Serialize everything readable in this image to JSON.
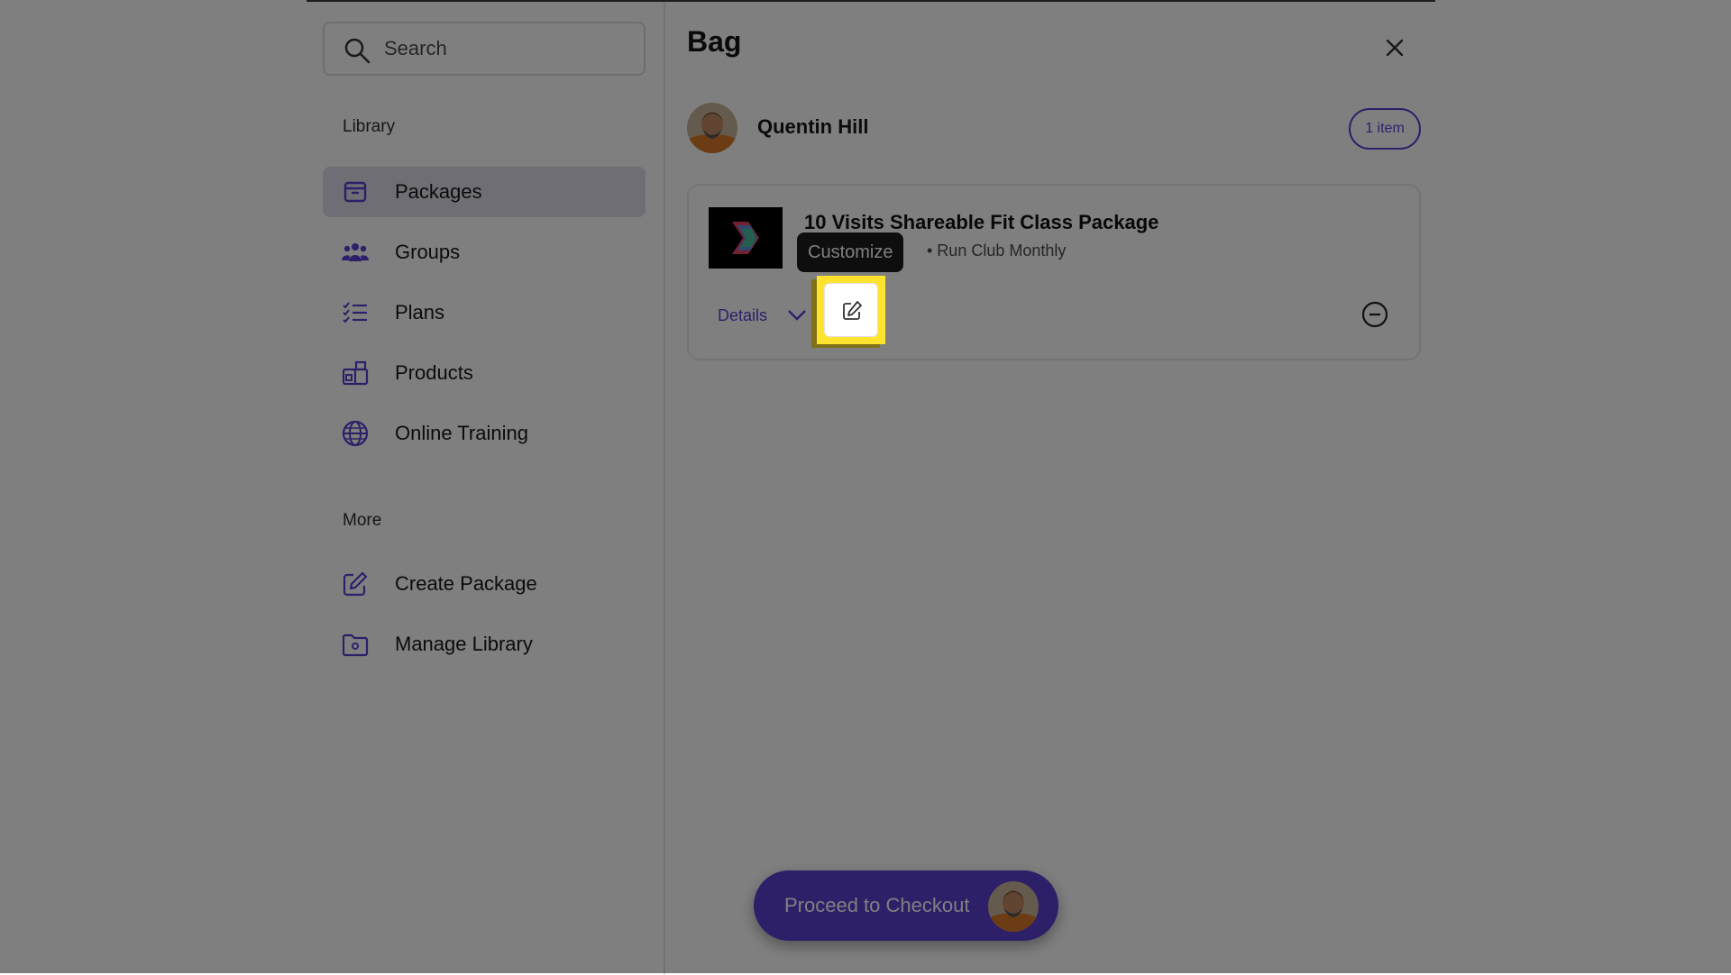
{
  "search": {
    "placeholder": "Search"
  },
  "sidebar": {
    "library_label": "Library",
    "items": [
      {
        "label": "Packages",
        "icon": "package-icon",
        "active": true
      },
      {
        "label": "Groups",
        "icon": "groups-icon",
        "active": false
      },
      {
        "label": "Plans",
        "icon": "plans-icon",
        "active": false
      },
      {
        "label": "Products",
        "icon": "products-icon",
        "active": false
      },
      {
        "label": "Online Training",
        "icon": "globe-icon",
        "active": false
      }
    ],
    "more_label": "More",
    "more_items": [
      {
        "label": "Create Package",
        "icon": "edit-icon"
      },
      {
        "label": "Manage Library",
        "icon": "folder-settings-icon"
      }
    ]
  },
  "bag": {
    "title": "Bag",
    "customer_name": "Quentin Hill",
    "item_count": "1 item",
    "item": {
      "title": "10 Visits Shareable Fit Class Package",
      "subtitle": "• Run Club Monthly",
      "details_label": "Details",
      "tooltip": "Customize"
    },
    "checkout_label": "Proceed to Checkout"
  },
  "colors": {
    "accent": "#5d3fd3",
    "highlight": "#ffe32e",
    "overlay": "rgba(0,0,0,0.5)"
  }
}
